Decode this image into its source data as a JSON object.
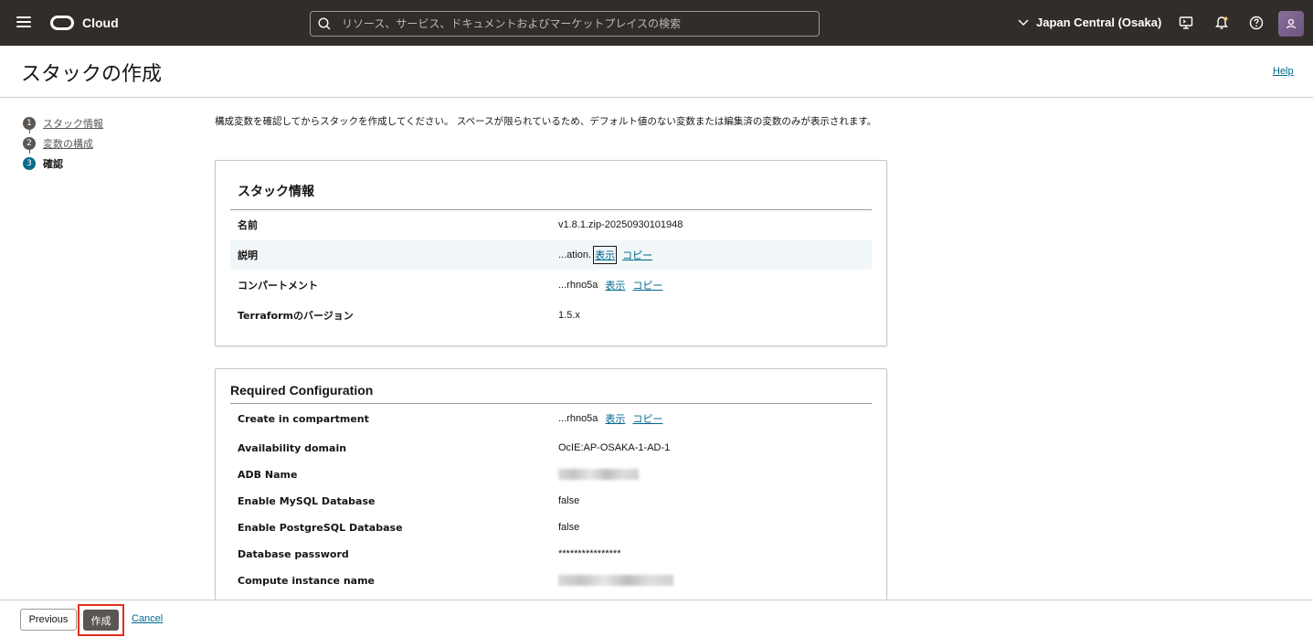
{
  "topbar": {
    "brand": "Cloud",
    "search_placeholder": "リソース、サービス、ドキュメントおよびマーケットプレイスの検索",
    "region": "Japan Central (Osaka)"
  },
  "page": {
    "title": "スタックの作成",
    "help": "Help",
    "intro": "構成変数を確認してからスタックを作成してください。 スペースが限られているため、デフォルト値のない変数または編集済の変数のみが表示されます。"
  },
  "steps": [
    {
      "num": "1",
      "label": "スタック情報"
    },
    {
      "num": "2",
      "label": "変数の構成"
    },
    {
      "num": "3",
      "label": "確認"
    }
  ],
  "stack_info": {
    "title": "スタック情報",
    "rows": [
      {
        "label": "名前",
        "value": "v1.8.1.zip-20250930101948"
      },
      {
        "label": "説明",
        "value": "...ation.",
        "show": "表示",
        "copy": "コピー"
      },
      {
        "label": "コンパートメント",
        "value": "...rhno5a",
        "show": "表示",
        "copy": "コピー"
      },
      {
        "label": "Terraformのバージョン",
        "value": "1.5.x"
      }
    ]
  },
  "required_config": {
    "title": "Required Configuration",
    "rows": [
      {
        "label": "Create in compartment",
        "value": "...rhno5a",
        "show": "表示",
        "copy": "コピー"
      },
      {
        "label": "Availability domain",
        "value": "OcIE:AP-OSAKA-1-AD-1"
      },
      {
        "label": "ADB Name",
        "value": ""
      },
      {
        "label": "Enable MySQL Database",
        "value": "false"
      },
      {
        "label": "Enable PostgreSQL Database",
        "value": "false"
      },
      {
        "label": "Database password",
        "value": "****************"
      },
      {
        "label": "Compute instance name",
        "value": ""
      }
    ]
  },
  "footer": {
    "previous": "Previous",
    "create": "作成",
    "cancel": "Cancel"
  }
}
